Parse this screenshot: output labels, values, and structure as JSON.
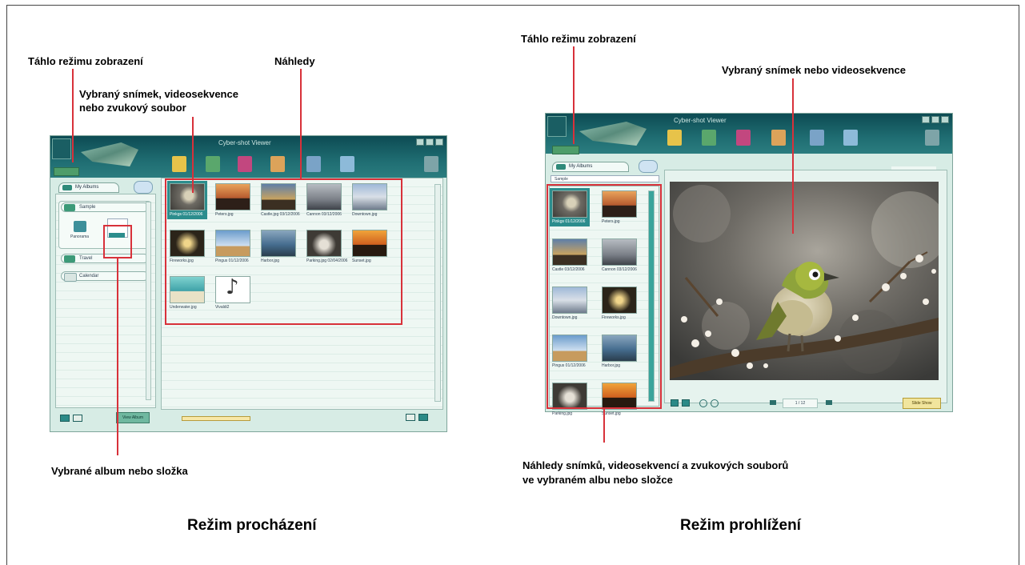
{
  "left": {
    "label_slider": "Táhlo režimu zobrazení",
    "label_thumbnails": "Náhledy",
    "label_selected_item_l1": "Vybraný snímek, videosekvence",
    "label_selected_item_l2": "nebo zvukový soubor",
    "label_selected_album": "Vybrané album nebo složka",
    "caption": "Režim procházení",
    "app": {
      "title": "Cyber-shot Viewer",
      "tab_label": "My Albums",
      "folders": [
        "Sample",
        "Travel",
        "Calendar"
      ],
      "album_items": [
        "Panorama",
        ""
      ],
      "thumbnails": [
        {
          "caption": "Pinkgs 01/12/2006",
          "kind": "bird",
          "selected": true
        },
        {
          "caption": "Peters.jpg",
          "kind": "sunset",
          "selected": false
        },
        {
          "caption": "Castle.jpg 03/12/2006",
          "kind": "dusk",
          "selected": false
        },
        {
          "caption": "Cannon 03/12/2006",
          "kind": "grey",
          "selected": false
        },
        {
          "caption": "Downtown.jpg",
          "kind": "city",
          "selected": false
        },
        {
          "caption": "Fireworks.jpg",
          "kind": "night",
          "selected": false
        },
        {
          "caption": "Pingus 01/12/2006",
          "kind": "sky",
          "selected": false
        },
        {
          "caption": "Harbor.jpg",
          "kind": "harbor",
          "selected": false
        },
        {
          "caption": "Parking.jpg 02/04/2006",
          "kind": "arch",
          "selected": false
        },
        {
          "caption": "Sunset.jpg",
          "kind": "orange",
          "selected": false
        },
        {
          "caption": "Underwater.jpg",
          "kind": "sea",
          "selected": false
        },
        {
          "caption": "Vivaldi2",
          "kind": "note",
          "selected": false
        }
      ],
      "footer_button": "View Album"
    }
  },
  "right": {
    "label_slider": "Táhlo režimu zobrazení",
    "label_selected": "Vybraný snímek nebo videosekvence",
    "label_thumbs_l1": "Náhledy snímků, videosekvencí a zvukových souborů",
    "label_thumbs_l2": "ve vybraném albu nebo složce",
    "caption": "Režim prohlížení",
    "app": {
      "title": "Cyber-shot Viewer",
      "tab_label": "My Albums",
      "folder_label": "Sample",
      "thumbnails": [
        {
          "caption": "Pinkgs 01/12/2006",
          "kind": "bird",
          "selected": true
        },
        {
          "caption": "Peters.jpg",
          "kind": "sunset",
          "selected": false
        },
        {
          "caption": "Castle 03/12/2006",
          "kind": "dusk",
          "selected": false
        },
        {
          "caption": "Cannon 03/12/2006",
          "kind": "grey",
          "selected": false
        },
        {
          "caption": "Downtown.jpg",
          "kind": "city",
          "selected": false
        },
        {
          "caption": "Fireworks.jpg",
          "kind": "night",
          "selected": false
        },
        {
          "caption": "Pingus 01/12/2006",
          "kind": "sky",
          "selected": false
        },
        {
          "caption": "Harbor.jpg",
          "kind": "harbor",
          "selected": false
        },
        {
          "caption": "Parking.jpg",
          "kind": "arch",
          "selected": false
        },
        {
          "caption": "Sunset.jpg",
          "kind": "orange",
          "selected": false
        }
      ],
      "page_counter": "1 / 12",
      "footer_button": "Slide Show"
    }
  },
  "colors": {
    "callout": "#d8313a",
    "window_bg": "#d7ece5",
    "header": "#0d4b53",
    "selection": "#2c8d8d"
  }
}
